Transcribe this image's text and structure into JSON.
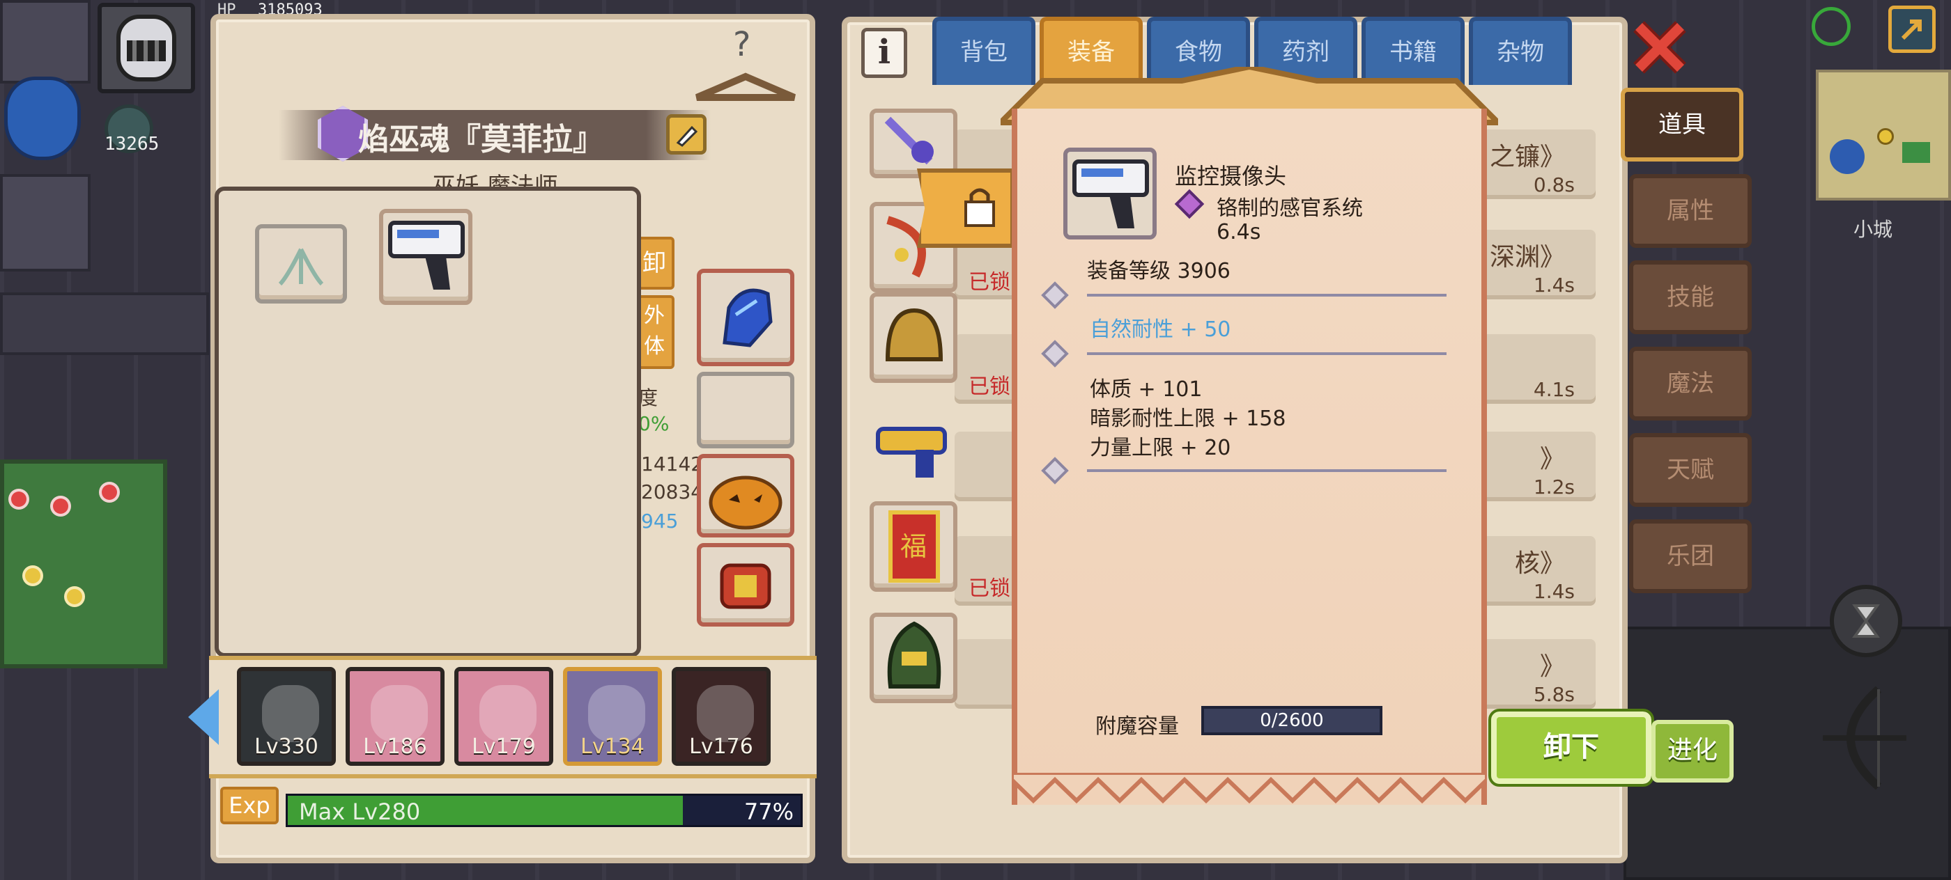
{
  "hud": {
    "currency_count": "13265",
    "hp_label": "HP",
    "hp_value": "3185093"
  },
  "minimap": {
    "location_name": "小城"
  },
  "character": {
    "name": "焰巫魂『莫菲拉』",
    "class_fragment": "巫妖 魔法师",
    "unequip_fragment": "卸",
    "outfit_fragment": "外\n体",
    "stat_label_fragment": "度",
    "stat_percent_fragment": "0%",
    "stat_number_1": "14142",
    "stat_number_2": "20834",
    "stat_number_3": "945",
    "exp_label": "Exp",
    "exp_text": "Max Lv280",
    "exp_percent": "77%",
    "exp_progress": 0.77
  },
  "party": [
    {
      "level": "Lv330"
    },
    {
      "level": "Lv186"
    },
    {
      "level": "Lv179"
    },
    {
      "level": "Lv134"
    },
    {
      "level": "Lv176"
    }
  ],
  "inventory_tabs": [
    "背包",
    "装备",
    "食物",
    "药剂",
    "书籍",
    "杂物"
  ],
  "active_tab": "装备",
  "side_menu": [
    "道具",
    "属性",
    "技能",
    "魔法",
    "天赋",
    "乐团"
  ],
  "active_side": "道具",
  "item_list": [
    {
      "title": "之镰》",
      "time": "0.8s",
      "locked_text": ""
    },
    {
      "title": "深渊》",
      "time": "1.4s",
      "locked_text": "已锁"
    },
    {
      "title": "",
      "time": "4.1s",
      "locked_text": "已锁"
    },
    {
      "title": "》",
      "time": "1.2s",
      "locked_text": ""
    },
    {
      "title": "核》",
      "time": "1.4s",
      "locked_text": "已锁"
    },
    {
      "title": "》",
      "time": "5.8s",
      "locked_text": ""
    }
  ],
  "tooltip": {
    "item_name": "监控摄像头",
    "set_name": "铬制的感官系统",
    "set_time": "6.4s",
    "equip_level": "装备等级 3906",
    "special_stat": "自然耐性 + 50",
    "stats": [
      "体质 + 101",
      "暗影耐性上限 + 158",
      "力量上限 + 20"
    ],
    "enchant_label": "附魔容量",
    "enchant_value": "0/2600",
    "enchant_progress": 0
  },
  "buttons": {
    "unequip": "卸下",
    "evolve": "进化"
  },
  "colors": {
    "tab_active": "#e4a33f",
    "tab_inactive": "#3b6aa8",
    "special_stat": "#4a9fd8",
    "exp_bar": "#3f9e35",
    "close_red": "#d93a2e",
    "unequip_green": "#9ecb3c"
  }
}
